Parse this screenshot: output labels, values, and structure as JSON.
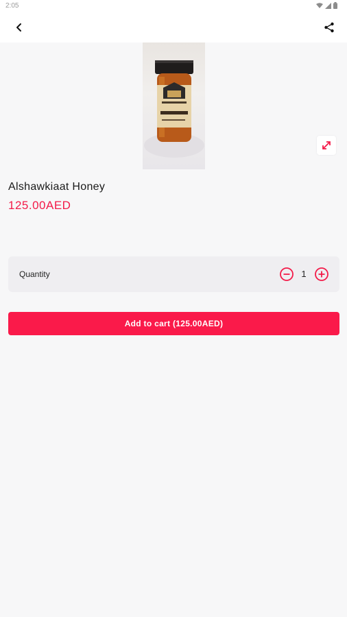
{
  "status_bar": {
    "time": "2:05"
  },
  "app_bar": {
    "back_icon": "arrow-left-icon",
    "share_icon": "share-icon"
  },
  "product": {
    "title": "Alshawkiaat Honey",
    "price": "125.00AED",
    "image_icon": "honey-jar-image"
  },
  "quantity": {
    "label": "Quantity",
    "value": "1"
  },
  "cart": {
    "button_label": "Add to cart (125.00AED)"
  },
  "colors": {
    "accent": "#fa1a4a",
    "price": "#f31a48",
    "card": "#efeef1",
    "background": "#f7f7f8"
  }
}
